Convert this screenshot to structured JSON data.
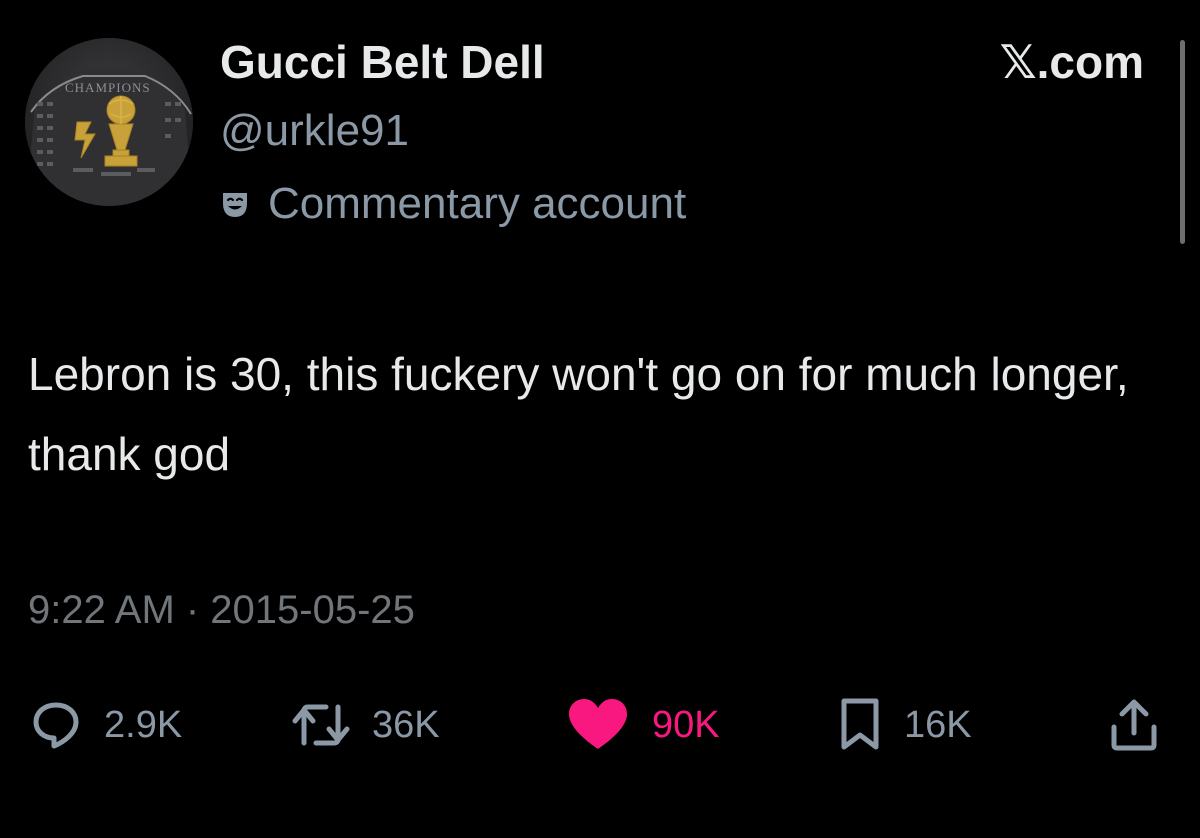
{
  "author": {
    "display_name": "Gucci Belt Dell",
    "handle": "@urkle91",
    "badge_label": "Commentary account",
    "avatar_icon": "championship-tshirt-trophy-avatar",
    "avatar_shirt_text": "CHAMPIONS"
  },
  "brand": {
    "label": "𝕏.com"
  },
  "tweet": {
    "text": "Lebron is 30, this fuckery won't go on for much longer, thank god",
    "timestamp": "9:22 AM · 2015-05-25"
  },
  "actions": {
    "replies": {
      "count": "2.9K",
      "icon": "reply-icon"
    },
    "reposts": {
      "count": "36K",
      "icon": "repost-icon"
    },
    "likes": {
      "count": "90K",
      "icon": "heart-icon",
      "liked": true
    },
    "bookmarks": {
      "count": "16K",
      "icon": "bookmark-icon"
    },
    "share": {
      "icon": "share-icon"
    }
  },
  "colors": {
    "background": "#000000",
    "primary_text": "#e7e9ea",
    "secondary_text": "#8b98a5",
    "like": "#f91880"
  }
}
